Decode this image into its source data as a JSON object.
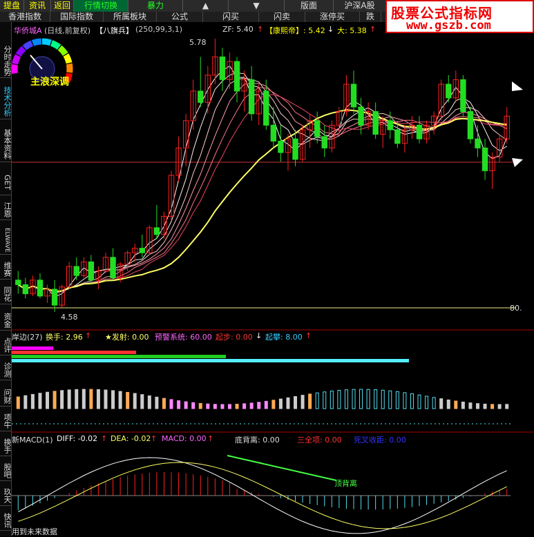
{
  "toolbar_top": {
    "items": [
      "提盘",
      "资讯",
      "返回",
      "行情切换",
      "暴力",
      "▲",
      "▼",
      "版面",
      "沪深A股"
    ]
  },
  "toolbar_second": {
    "items": [
      "香港指数",
      "国际指数",
      "所属板块",
      "公式",
      "闪买",
      "闪卖",
      "涨停买",
      "跌"
    ]
  },
  "watermark": {
    "line1": "股票公式指标网",
    "line2": "www.gszb.com"
  },
  "sidebar": {
    "items": [
      "分时走势",
      "技术分析",
      "基本资料",
      "GET",
      "江恩",
      "ELWAVE",
      "维赛",
      "同花",
      "资金",
      "点评",
      "诊测",
      "问财",
      "项牛",
      "换手",
      "股吧",
      "玖天",
      "快讯"
    ],
    "active_index": 1
  },
  "main_panel": {
    "stock_name": "华侨城A",
    "period": "(日线,前复权)",
    "indicator": "【八旗兵】",
    "params": "(250,99,3,1)",
    "zf": "ZF: 5.40",
    "kangxi": "【康熙帝】: 5.42",
    "da": "大: 5.38",
    "gauge_label": "主浪深调",
    "high_label": "5.78",
    "low_label": "4.58",
    "right_label": "80."
  },
  "panel2": {
    "name": "岸边(27)",
    "huanshou": "换手: 2.96",
    "fashe": "★发射: 0.00",
    "yujing": "预警系统: 60.00",
    "qibu": "起步: 0.00",
    "qipan": "起攀: 8.00"
  },
  "panel3": {
    "name": "新MACD(1)",
    "diff": "DIFF: -0.02",
    "dea": "DEA: -0.02",
    "macd": "MACD: 0.00",
    "dibeili": "底背离: 0.00",
    "sanquan": "三全项: 0.00",
    "sicha": "死叉收距: 0.00",
    "dingbeili": "顶背离"
  },
  "footer": {
    "text": "用到未来数据"
  },
  "colors": {
    "up": "#ff2020",
    "down": "#22dd22",
    "ma_yellow": "#ffff66",
    "cyan": "#55e0f0",
    "magenta": "#ff66ff"
  },
  "chart_data": {
    "type": "candlestick",
    "price_range": [
      4.58,
      5.78
    ],
    "high": 5.78,
    "low": 4.58,
    "candles": [
      [
        4.72,
        4.76,
        4.66,
        4.7
      ],
      [
        4.7,
        4.73,
        4.64,
        4.66
      ],
      [
        4.66,
        4.74,
        4.65,
        4.72
      ],
      [
        4.72,
        4.75,
        4.64,
        4.65
      ],
      [
        4.65,
        4.7,
        4.62,
        4.68
      ],
      [
        4.68,
        4.72,
        4.58,
        4.61
      ],
      [
        4.61,
        4.7,
        4.6,
        4.69
      ],
      [
        4.69,
        4.8,
        4.68,
        4.78
      ],
      [
        4.78,
        4.82,
        4.72,
        4.74
      ],
      [
        4.74,
        4.82,
        4.73,
        4.8
      ],
      [
        4.8,
        4.83,
        4.7,
        4.72
      ],
      [
        4.72,
        4.78,
        4.68,
        4.76
      ],
      [
        4.76,
        4.84,
        4.75,
        4.82
      ],
      [
        4.82,
        4.86,
        4.72,
        4.73
      ],
      [
        4.73,
        4.8,
        4.71,
        4.79
      ],
      [
        4.79,
        4.85,
        4.76,
        4.84
      ],
      [
        4.84,
        4.88,
        4.8,
        4.86
      ],
      [
        4.86,
        4.92,
        4.82,
        4.84
      ],
      [
        4.84,
        4.96,
        4.83,
        4.95
      ],
      [
        4.95,
        5.05,
        4.9,
        4.92
      ],
      [
        4.92,
        5.02,
        4.9,
        5.0
      ],
      [
        5.0,
        5.2,
        4.98,
        5.18
      ],
      [
        5.18,
        5.35,
        5.15,
        5.3
      ],
      [
        5.3,
        5.45,
        5.22,
        5.42
      ],
      [
        5.42,
        5.6,
        5.38,
        5.55
      ],
      [
        5.55,
        5.7,
        5.48,
        5.5
      ],
      [
        5.5,
        5.66,
        5.45,
        5.62
      ],
      [
        5.62,
        5.78,
        5.58,
        5.7
      ],
      [
        5.7,
        5.74,
        5.55,
        5.6
      ],
      [
        5.6,
        5.72,
        5.56,
        5.68
      ],
      [
        5.68,
        5.7,
        5.5,
        5.55
      ],
      [
        5.55,
        5.64,
        5.46,
        5.6
      ],
      [
        5.6,
        5.66,
        5.42,
        5.45
      ],
      [
        5.45,
        5.58,
        5.4,
        5.55
      ],
      [
        5.55,
        5.6,
        5.38,
        5.4
      ],
      [
        5.4,
        5.48,
        5.3,
        5.33
      ],
      [
        5.33,
        5.4,
        5.24,
        5.28
      ],
      [
        5.28,
        5.36,
        5.2,
        5.34
      ],
      [
        5.34,
        5.38,
        5.22,
        5.25
      ],
      [
        5.25,
        5.4,
        5.24,
        5.38
      ],
      [
        5.38,
        5.45,
        5.3,
        5.42
      ],
      [
        5.42,
        5.46,
        5.32,
        5.35
      ],
      [
        5.35,
        5.4,
        5.26,
        5.3
      ],
      [
        5.3,
        5.42,
        5.28,
        5.4
      ],
      [
        5.4,
        5.48,
        5.36,
        5.46
      ],
      [
        5.46,
        5.62,
        5.44,
        5.58
      ],
      [
        5.58,
        5.64,
        5.45,
        5.48
      ],
      [
        5.48,
        5.52,
        5.36,
        5.4
      ],
      [
        5.4,
        5.5,
        5.38,
        5.46
      ],
      [
        5.46,
        5.5,
        5.34,
        5.36
      ],
      [
        5.36,
        5.44,
        5.3,
        5.42
      ],
      [
        5.42,
        5.46,
        5.34,
        5.38
      ],
      [
        5.38,
        5.42,
        5.3,
        5.32
      ],
      [
        5.32,
        5.4,
        5.28,
        5.38
      ],
      [
        5.38,
        5.44,
        5.34,
        5.4
      ],
      [
        5.4,
        5.44,
        5.32,
        5.34
      ],
      [
        5.34,
        5.42,
        5.32,
        5.4
      ],
      [
        5.4,
        5.46,
        5.36,
        5.44
      ],
      [
        5.44,
        5.6,
        5.42,
        5.58
      ],
      [
        5.58,
        5.62,
        5.5,
        5.52
      ],
      [
        5.52,
        5.64,
        5.5,
        5.6
      ],
      [
        5.6,
        5.62,
        5.44,
        5.46
      ],
      [
        5.46,
        5.48,
        5.32,
        5.34
      ],
      [
        5.34,
        5.4,
        5.26,
        5.3
      ],
      [
        5.3,
        5.34,
        5.16,
        5.2
      ],
      [
        5.2,
        5.28,
        5.12,
        5.26
      ],
      [
        5.26,
        5.36,
        5.24,
        5.34
      ],
      [
        5.34,
        5.48,
        5.32,
        5.44
      ]
    ]
  }
}
